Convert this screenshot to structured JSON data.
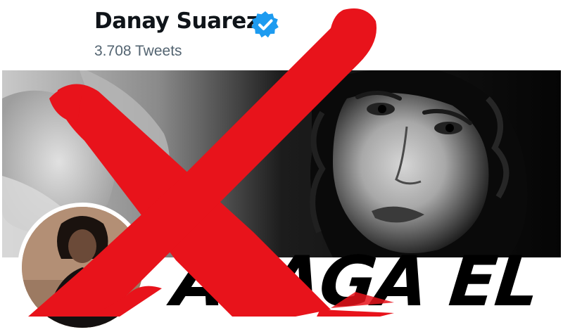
{
  "profile": {
    "display_name": "Danay Suarez",
    "verified_icon": "verified-badge-icon",
    "tweet_count": "3.708 Tweets"
  },
  "overlay": {
    "caption": "APAGA EL",
    "cross_icon": "red-x-cross",
    "cross_color": "#e8131b"
  },
  "colors": {
    "verified_blue": "#1d9bf0",
    "name_text": "#0f1419",
    "secondary_text": "#536471"
  }
}
